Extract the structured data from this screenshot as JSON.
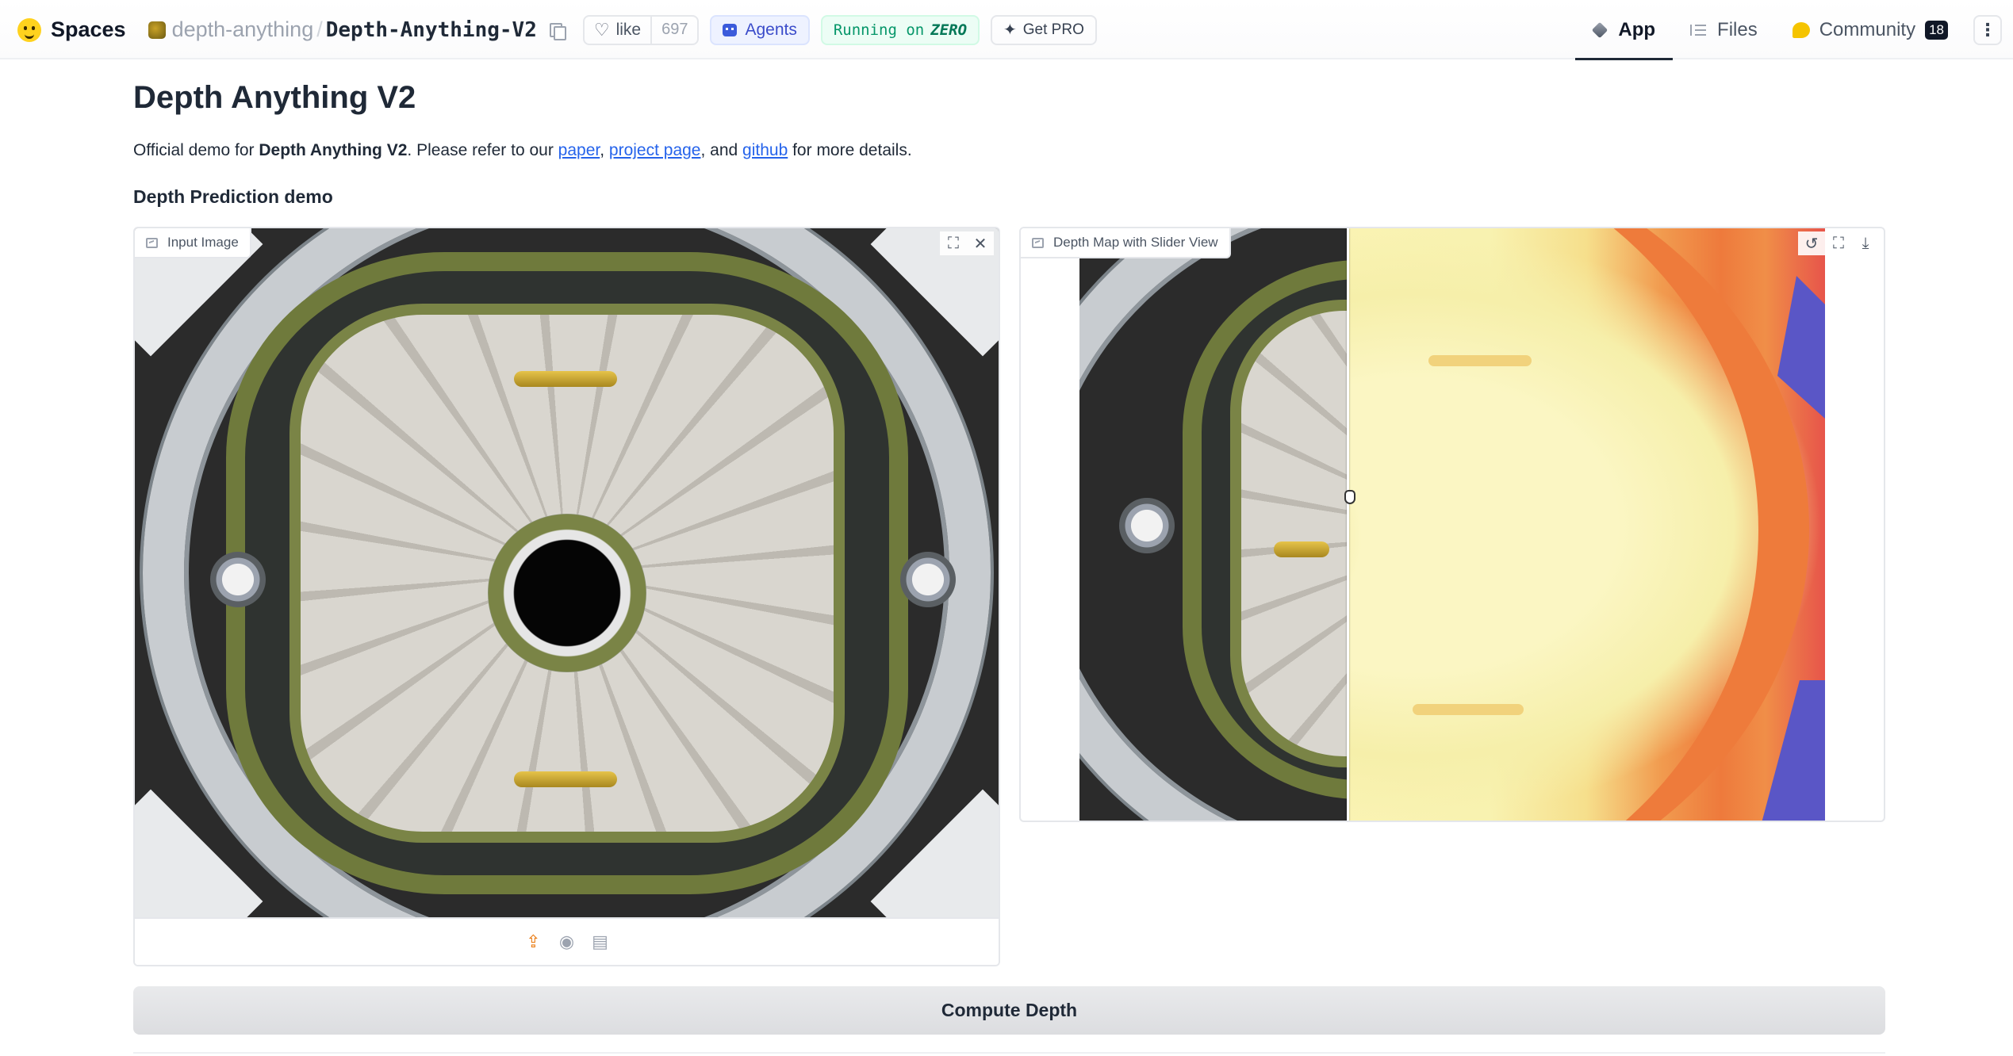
{
  "header": {
    "spaces_label": "Spaces",
    "org_name": "depth-anything",
    "separator": "/",
    "repo_name": "Depth-Anything-V2",
    "like_label": "like",
    "like_count": "697",
    "agents_label": "Agents",
    "running_prefix": "Running on",
    "running_hardware": "ZERO",
    "pro_label": "Get PRO",
    "tabs": [
      {
        "label": "App",
        "active": true
      },
      {
        "label": "Files",
        "active": false
      },
      {
        "label": "Community",
        "active": false,
        "badge": "18"
      }
    ],
    "menu_glyph": "⋮"
  },
  "main": {
    "title": "Depth Anything V2",
    "description": {
      "prefix": "Official demo for ",
      "bold": "Depth Anything V2",
      "middle": ". Please refer to our ",
      "link1": "paper",
      "sep1": ", ",
      "link2": "project page",
      "sep2": ", and ",
      "link3": "github",
      "suffix": " for more details."
    },
    "section_title": "Depth Prediction demo",
    "input_panel": {
      "label": "Input Image",
      "tools": {
        "fullscreen": "⛶",
        "close": "✕"
      },
      "upload_tools": {
        "upload": "⇪",
        "webcam": "◉",
        "clipboard": "▤"
      }
    },
    "output_panel": {
      "label": "Depth Map with Slider View",
      "tools": {
        "undo": "↺",
        "fullscreen": "⛶",
        "download": "⤓"
      },
      "slider_position": 0.36
    },
    "compute_button": "Compute Depth"
  },
  "icons": {
    "logo": "hugging-face-logo",
    "copy": "copy-icon",
    "like": "heart-icon",
    "image": "image-icon"
  },
  "colors": {
    "link": "#2563eb",
    "running": "#059669",
    "agents": "#3b4cca"
  }
}
